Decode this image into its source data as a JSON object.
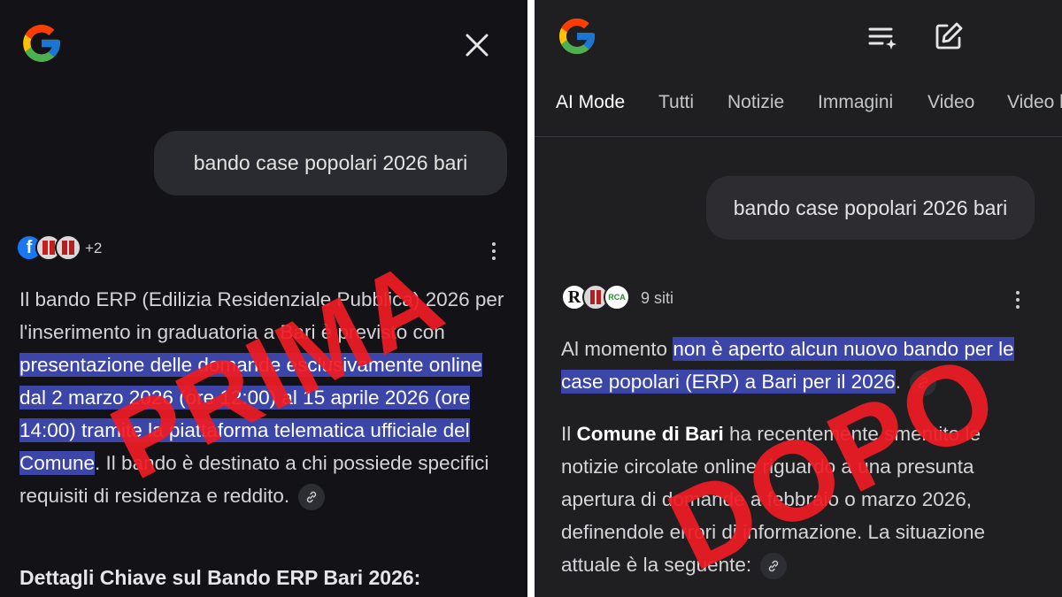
{
  "left_panel": {
    "query": "bando case popolari 2026 bari",
    "sources_more": "+2",
    "paragraph_before_highlight": "Il bando ERP (Edilizia Residenziale Pubblica) 2026 per l'inserimento in graduatoria a Bari è previsto con ",
    "paragraph_highlight": "presentazione delle domande esclusivamente online dal 2 marzo 2026 (ore 12:00) al 15 aprile 2026 (ore 14:00) tramite la piattaforma telematica ufficiale del Comune",
    "paragraph_after_highlight": ". Il bando è destinato a chi possiede specifici requisiti di residenza e reddito.",
    "section_heading": "Dettagli Chiave sul Bando ERP Bari 2026:",
    "stamp": "PRIMA"
  },
  "right_panel": {
    "tabs": [
      "AI Mode",
      "Tutti",
      "Notizie",
      "Immagini",
      "Video",
      "Video b"
    ],
    "active_tab": "AI Mode",
    "query": "bando case popolari 2026 bari",
    "sources_count": "9 siti",
    "p1_before": "Al momento ",
    "p1_highlight": "non è aperto alcun nuovo bando per le case popolari (ERP) a Bari per il 2026",
    "p1_after": ".",
    "p2_before": "Il ",
    "p2_bold": "Comune di Bari",
    "p2_after": " ha recentemente smentito le notizie circolate online riguardo a una presunta apertura di domande a febbraio o marzo 2026, definendole errori di informazione. La situazione attuale è la seguente:",
    "stamp": "DOPO"
  },
  "colors": {
    "highlight": "#3c45a8",
    "stamp_red": "#ee1c24",
    "background_dark": "#14141a"
  },
  "icons": [
    "google-logo-icon",
    "close-icon",
    "list-sparkle-icon",
    "edit-icon",
    "link-icon",
    "more-vert-icon"
  ]
}
